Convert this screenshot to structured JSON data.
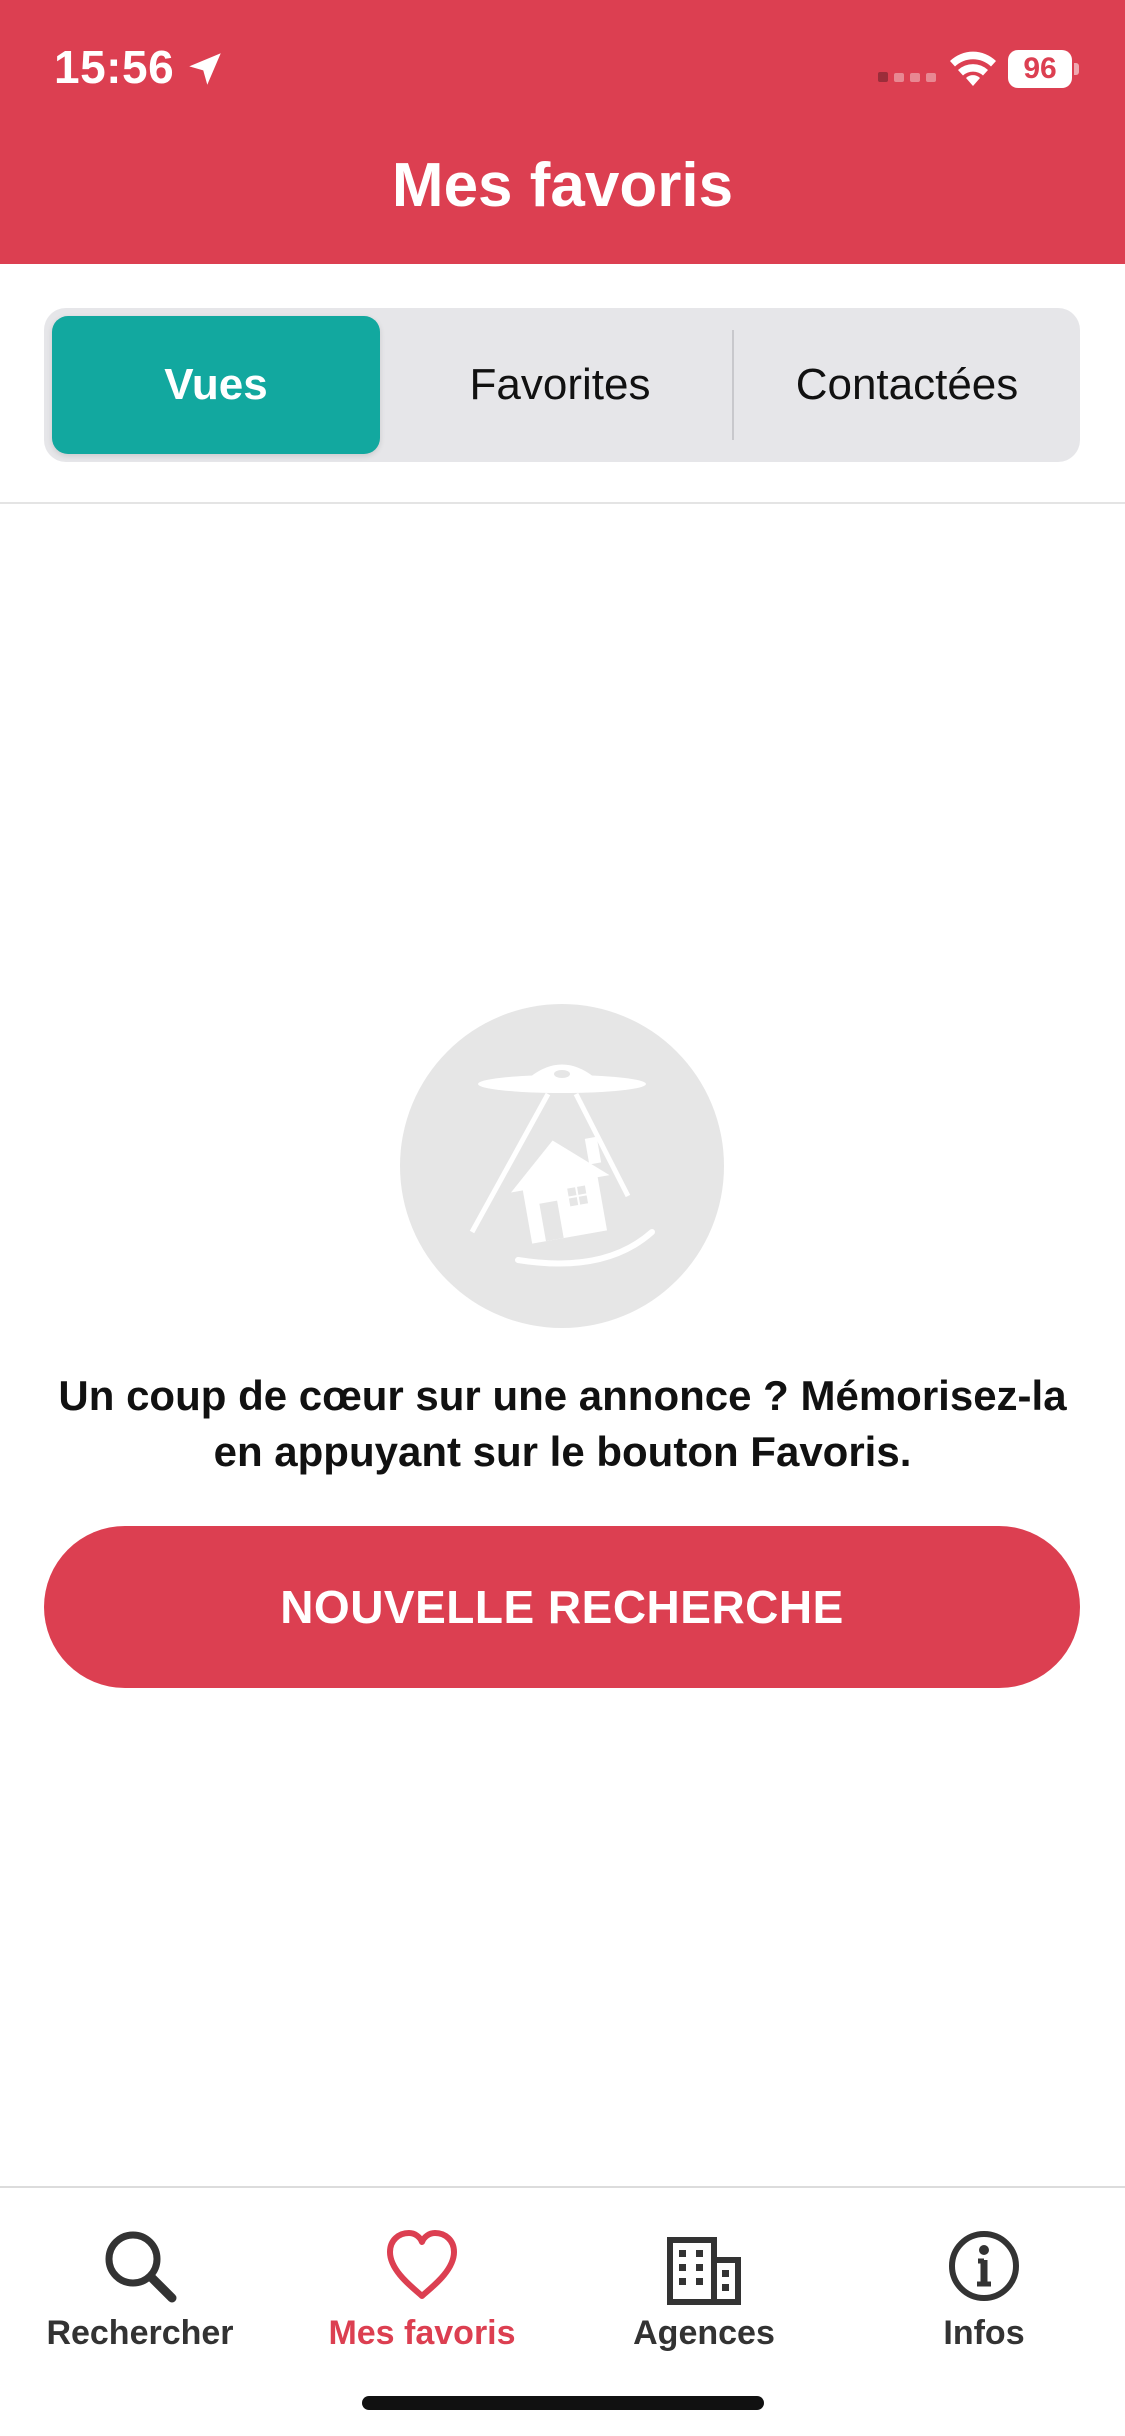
{
  "status_bar": {
    "time": "15:56",
    "battery": "96",
    "icons": [
      "location-arrow-icon",
      "signal-icon",
      "wifi-icon",
      "battery-icon"
    ]
  },
  "header": {
    "title": "Mes favoris",
    "background_color": "#dc3f51"
  },
  "segmented_control": {
    "items": [
      {
        "label": "Vues",
        "selected": true
      },
      {
        "label": "Favorites",
        "selected": false
      },
      {
        "label": "Contactées",
        "selected": false
      }
    ],
    "active_color": "#12a89f"
  },
  "empty_state": {
    "illustration_icon": "ufo-house-icon",
    "message": "Un coup de cœur sur une annonce ? Mémorisez-la en appuyant sur le bouton Favoris.",
    "button_label": "NOUVELLE RECHERCHE",
    "button_color": "#dc3f51"
  },
  "tab_bar": {
    "items": [
      {
        "label": "Rechercher",
        "icon": "search-icon",
        "active": false
      },
      {
        "label": "Mes favoris",
        "icon": "heart-icon",
        "active": true
      },
      {
        "label": "Agences",
        "icon": "building-icon",
        "active": false
      },
      {
        "label": "Infos",
        "icon": "info-icon",
        "active": false
      }
    ],
    "active_color": "#dc3f51"
  }
}
